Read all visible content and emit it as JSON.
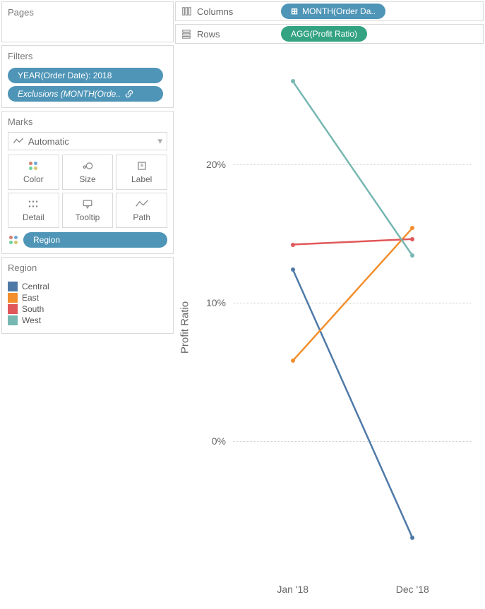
{
  "shelves": {
    "columns": {
      "label": "Columns",
      "pill": "MONTH(Order Da.."
    },
    "rows": {
      "label": "Rows",
      "pill": "AGG(Profit Ratio)"
    }
  },
  "pages": {
    "title": "Pages"
  },
  "filters": {
    "title": "Filters",
    "items": [
      "YEAR(Order Date): 2018",
      "Exclusions (MONTH(Orde.."
    ]
  },
  "marks": {
    "title": "Marks",
    "type": "Automatic",
    "buttons": [
      "Color",
      "Size",
      "Label",
      "Detail",
      "Tooltip",
      "Path"
    ],
    "color_pill": "Region"
  },
  "legend": {
    "title": "Region",
    "items": [
      {
        "label": "Central",
        "color": "#4e79a7"
      },
      {
        "label": "East",
        "color": "#f28e2b"
      },
      {
        "label": "South",
        "color": "#e15759"
      },
      {
        "label": "West",
        "color": "#76b7b2"
      }
    ]
  },
  "chart_data": {
    "type": "line",
    "ylabel": "Profit Ratio",
    "xlabel": "",
    "title": "",
    "x": [
      "Jan '18",
      "Dec '18"
    ],
    "y_ticks": [
      0,
      10,
      20
    ],
    "y_fmt": "percent",
    "ylim": [
      -10,
      28
    ],
    "series": [
      {
        "name": "Central",
        "color": "#4e79a7",
        "values": [
          12.4,
          -7.0
        ]
      },
      {
        "name": "East",
        "color": "#f28e2b",
        "values": [
          5.8,
          15.4
        ]
      },
      {
        "name": "South",
        "color": "#e15759",
        "values": [
          14.2,
          14.6
        ]
      },
      {
        "name": "West",
        "color": "#76b7b2",
        "values": [
          26.0,
          13.4
        ]
      }
    ]
  }
}
